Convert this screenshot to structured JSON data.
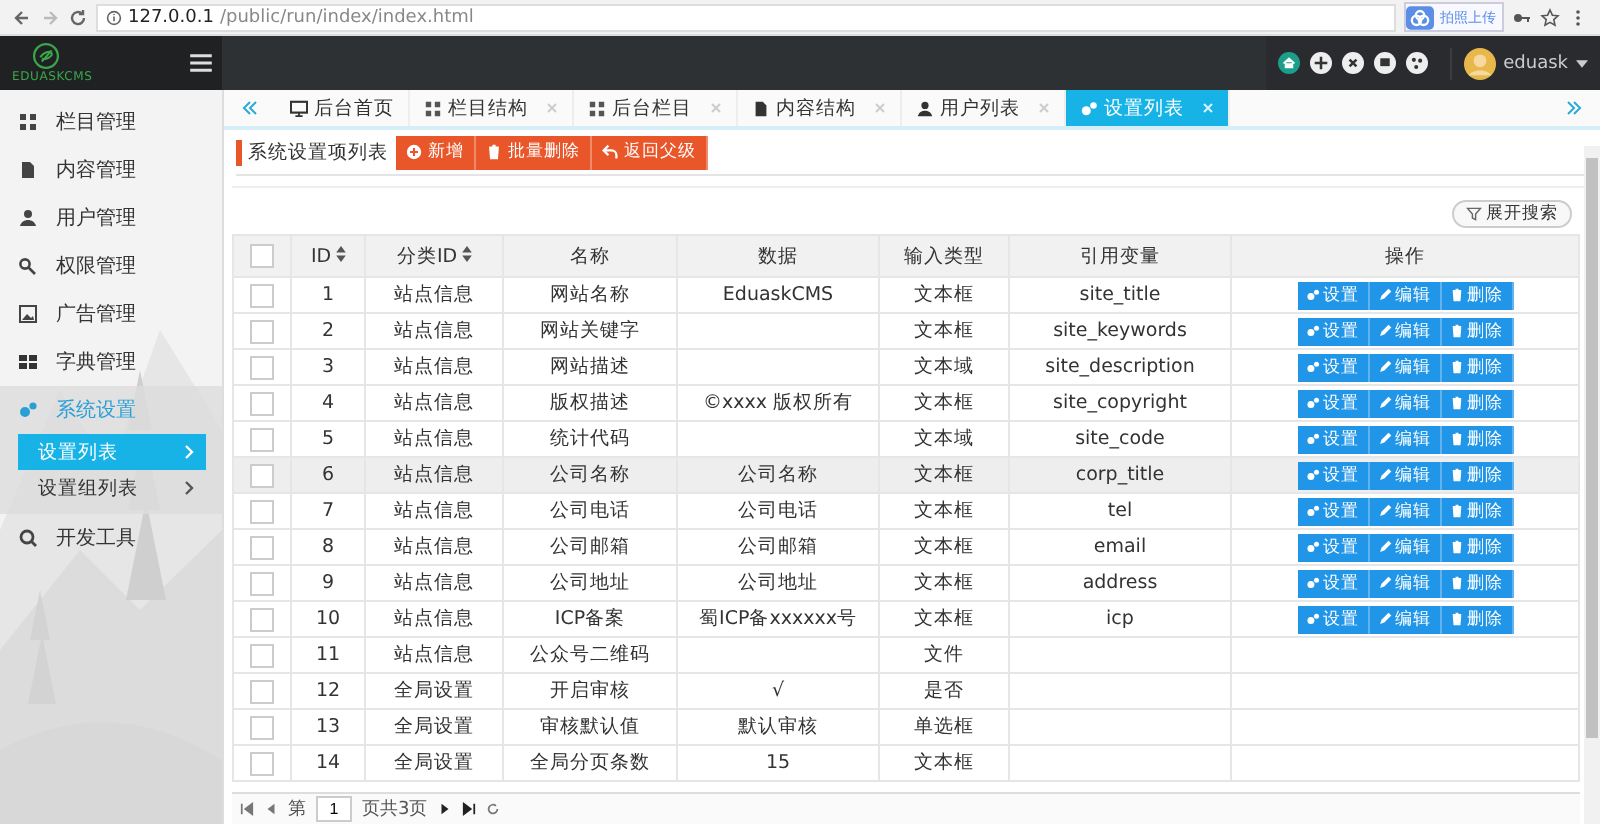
{
  "browser": {
    "url_host": "127.0.0.1",
    "url_path": "/public/run/index/index.html",
    "extension_label": "拍照上传"
  },
  "header": {
    "logo_text": "EDUASKCMS",
    "user": "eduask"
  },
  "sidebar": {
    "items": [
      {
        "label": "栏目管理",
        "expanded": false
      },
      {
        "label": "内容管理",
        "expanded": false
      },
      {
        "label": "用户管理",
        "expanded": false
      },
      {
        "label": "权限管理",
        "expanded": false
      },
      {
        "label": "广告管理",
        "expanded": false
      },
      {
        "label": "字典管理",
        "expanded": false
      },
      {
        "label": "系统设置",
        "expanded": true,
        "children": [
          {
            "label": "设置列表",
            "selected": true
          },
          {
            "label": "设置组列表",
            "selected": false
          }
        ]
      },
      {
        "label": "开发工具",
        "expanded": false
      }
    ]
  },
  "tabs": [
    {
      "label": "后台首页",
      "closable": false,
      "selected": false
    },
    {
      "label": "栏目结构",
      "closable": true,
      "selected": false
    },
    {
      "label": "后台栏目",
      "closable": true,
      "selected": false
    },
    {
      "label": "内容结构",
      "closable": true,
      "selected": false
    },
    {
      "label": "用户列表",
      "closable": true,
      "selected": false
    },
    {
      "label": "设置列表",
      "closable": true,
      "selected": true
    }
  ],
  "page_title": "系统设置项列表",
  "toolbar": [
    "新增",
    "批量删除",
    "返回父级"
  ],
  "search_toggle": "展开搜索",
  "table": {
    "select_all": {
      "checked": false
    },
    "columns": [
      {
        "label": "ID",
        "sortable": true
      },
      {
        "label": "分类ID",
        "sortable": true
      },
      {
        "label": "名称",
        "sortable": false
      },
      {
        "label": "数据",
        "sortable": false
      },
      {
        "label": "输入类型",
        "sortable": false
      },
      {
        "label": "引用变量",
        "sortable": false
      },
      {
        "label": "操作",
        "sortable": false
      }
    ],
    "rows": [
      {
        "checked": false,
        "hovered": false,
        "cells": [
          "1",
          "站点信息",
          "网站名称",
          "EduaskCMS",
          "文本框",
          "site_title"
        ],
        "actions": [
          "设置",
          "编辑",
          "删除"
        ]
      },
      {
        "checked": false,
        "hovered": false,
        "cells": [
          "2",
          "站点信息",
          "网站关键字",
          "",
          "文本框",
          "site_keywords"
        ],
        "actions": [
          "设置",
          "编辑",
          "删除"
        ]
      },
      {
        "checked": false,
        "hovered": false,
        "cells": [
          "3",
          "站点信息",
          "网站描述",
          "",
          "文本域",
          "site_description"
        ],
        "actions": [
          "设置",
          "编辑",
          "删除"
        ]
      },
      {
        "checked": false,
        "hovered": false,
        "cells": [
          "4",
          "站点信息",
          "版权描述",
          "©xxxx 版权所有",
          "文本框",
          "site_copyright"
        ],
        "actions": [
          "设置",
          "编辑",
          "删除"
        ]
      },
      {
        "checked": false,
        "hovered": false,
        "cells": [
          "5",
          "站点信息",
          "统计代码",
          "",
          "文本域",
          "site_code"
        ],
        "actions": [
          "设置",
          "编辑",
          "删除"
        ]
      },
      {
        "checked": false,
        "hovered": true,
        "cells": [
          "6",
          "站点信息",
          "公司名称",
          "公司名称",
          "文本框",
          "corp_title"
        ],
        "actions": [
          "设置",
          "编辑",
          "删除"
        ]
      },
      {
        "checked": false,
        "hovered": false,
        "cells": [
          "7",
          "站点信息",
          "公司电话",
          "公司电话",
          "文本框",
          "tel"
        ],
        "actions": [
          "设置",
          "编辑",
          "删除"
        ]
      },
      {
        "checked": false,
        "hovered": false,
        "cells": [
          "8",
          "站点信息",
          "公司邮箱",
          "公司邮箱",
          "文本框",
          "email"
        ],
        "actions": [
          "设置",
          "编辑",
          "删除"
        ]
      },
      {
        "checked": false,
        "hovered": false,
        "cells": [
          "9",
          "站点信息",
          "公司地址",
          "公司地址",
          "文本框",
          "address"
        ],
        "actions": [
          "设置",
          "编辑",
          "删除"
        ]
      },
      {
        "checked": false,
        "hovered": false,
        "cells": [
          "10",
          "站点信息",
          "ICP备案",
          "蜀ICP备xxxxxx号",
          "文本框",
          "icp"
        ],
        "actions": [
          "设置",
          "编辑",
          "删除"
        ]
      },
      {
        "checked": false,
        "hovered": false,
        "cells": [
          "11",
          "站点信息",
          "公众号二维码",
          "",
          "文件",
          ""
        ]
      },
      {
        "checked": false,
        "hovered": false,
        "cells": [
          "12",
          "全局设置",
          "开启审核",
          "√",
          "是否",
          ""
        ]
      },
      {
        "checked": false,
        "hovered": false,
        "cells": [
          "13",
          "全局设置",
          "审核默认值",
          "默认审核",
          "单选框",
          ""
        ]
      },
      {
        "checked": false,
        "hovered": false,
        "cells": [
          "14",
          "全局设置",
          "全局分页条数",
          "15",
          "文本框",
          ""
        ]
      }
    ]
  },
  "pager": {
    "prefix": "第",
    "page": "1",
    "suffix": "页共3页"
  }
}
